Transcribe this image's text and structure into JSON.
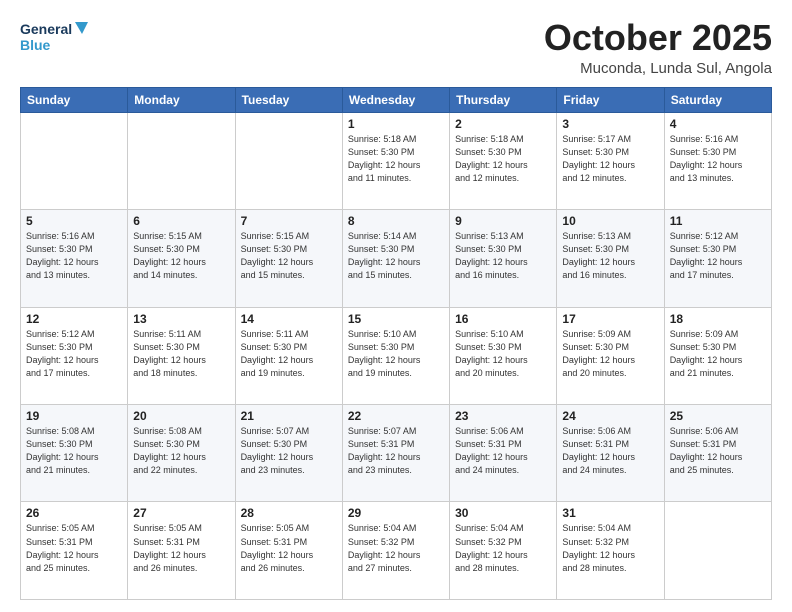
{
  "header": {
    "logo_line1": "General",
    "logo_line2": "Blue",
    "month": "October 2025",
    "location": "Muconda, Lunda Sul, Angola"
  },
  "days_of_week": [
    "Sunday",
    "Monday",
    "Tuesday",
    "Wednesday",
    "Thursday",
    "Friday",
    "Saturday"
  ],
  "weeks": [
    [
      {
        "day": "",
        "info": ""
      },
      {
        "day": "",
        "info": ""
      },
      {
        "day": "",
        "info": ""
      },
      {
        "day": "1",
        "info": "Sunrise: 5:18 AM\nSunset: 5:30 PM\nDaylight: 12 hours\nand 11 minutes."
      },
      {
        "day": "2",
        "info": "Sunrise: 5:18 AM\nSunset: 5:30 PM\nDaylight: 12 hours\nand 12 minutes."
      },
      {
        "day": "3",
        "info": "Sunrise: 5:17 AM\nSunset: 5:30 PM\nDaylight: 12 hours\nand 12 minutes."
      },
      {
        "day": "4",
        "info": "Sunrise: 5:16 AM\nSunset: 5:30 PM\nDaylight: 12 hours\nand 13 minutes."
      }
    ],
    [
      {
        "day": "5",
        "info": "Sunrise: 5:16 AM\nSunset: 5:30 PM\nDaylight: 12 hours\nand 13 minutes."
      },
      {
        "day": "6",
        "info": "Sunrise: 5:15 AM\nSunset: 5:30 PM\nDaylight: 12 hours\nand 14 minutes."
      },
      {
        "day": "7",
        "info": "Sunrise: 5:15 AM\nSunset: 5:30 PM\nDaylight: 12 hours\nand 15 minutes."
      },
      {
        "day": "8",
        "info": "Sunrise: 5:14 AM\nSunset: 5:30 PM\nDaylight: 12 hours\nand 15 minutes."
      },
      {
        "day": "9",
        "info": "Sunrise: 5:13 AM\nSunset: 5:30 PM\nDaylight: 12 hours\nand 16 minutes."
      },
      {
        "day": "10",
        "info": "Sunrise: 5:13 AM\nSunset: 5:30 PM\nDaylight: 12 hours\nand 16 minutes."
      },
      {
        "day": "11",
        "info": "Sunrise: 5:12 AM\nSunset: 5:30 PM\nDaylight: 12 hours\nand 17 minutes."
      }
    ],
    [
      {
        "day": "12",
        "info": "Sunrise: 5:12 AM\nSunset: 5:30 PM\nDaylight: 12 hours\nand 17 minutes."
      },
      {
        "day": "13",
        "info": "Sunrise: 5:11 AM\nSunset: 5:30 PM\nDaylight: 12 hours\nand 18 minutes."
      },
      {
        "day": "14",
        "info": "Sunrise: 5:11 AM\nSunset: 5:30 PM\nDaylight: 12 hours\nand 19 minutes."
      },
      {
        "day": "15",
        "info": "Sunrise: 5:10 AM\nSunset: 5:30 PM\nDaylight: 12 hours\nand 19 minutes."
      },
      {
        "day": "16",
        "info": "Sunrise: 5:10 AM\nSunset: 5:30 PM\nDaylight: 12 hours\nand 20 minutes."
      },
      {
        "day": "17",
        "info": "Sunrise: 5:09 AM\nSunset: 5:30 PM\nDaylight: 12 hours\nand 20 minutes."
      },
      {
        "day": "18",
        "info": "Sunrise: 5:09 AM\nSunset: 5:30 PM\nDaylight: 12 hours\nand 21 minutes."
      }
    ],
    [
      {
        "day": "19",
        "info": "Sunrise: 5:08 AM\nSunset: 5:30 PM\nDaylight: 12 hours\nand 21 minutes."
      },
      {
        "day": "20",
        "info": "Sunrise: 5:08 AM\nSunset: 5:30 PM\nDaylight: 12 hours\nand 22 minutes."
      },
      {
        "day": "21",
        "info": "Sunrise: 5:07 AM\nSunset: 5:30 PM\nDaylight: 12 hours\nand 23 minutes."
      },
      {
        "day": "22",
        "info": "Sunrise: 5:07 AM\nSunset: 5:31 PM\nDaylight: 12 hours\nand 23 minutes."
      },
      {
        "day": "23",
        "info": "Sunrise: 5:06 AM\nSunset: 5:31 PM\nDaylight: 12 hours\nand 24 minutes."
      },
      {
        "day": "24",
        "info": "Sunrise: 5:06 AM\nSunset: 5:31 PM\nDaylight: 12 hours\nand 24 minutes."
      },
      {
        "day": "25",
        "info": "Sunrise: 5:06 AM\nSunset: 5:31 PM\nDaylight: 12 hours\nand 25 minutes."
      }
    ],
    [
      {
        "day": "26",
        "info": "Sunrise: 5:05 AM\nSunset: 5:31 PM\nDaylight: 12 hours\nand 25 minutes."
      },
      {
        "day": "27",
        "info": "Sunrise: 5:05 AM\nSunset: 5:31 PM\nDaylight: 12 hours\nand 26 minutes."
      },
      {
        "day": "28",
        "info": "Sunrise: 5:05 AM\nSunset: 5:31 PM\nDaylight: 12 hours\nand 26 minutes."
      },
      {
        "day": "29",
        "info": "Sunrise: 5:04 AM\nSunset: 5:32 PM\nDaylight: 12 hours\nand 27 minutes."
      },
      {
        "day": "30",
        "info": "Sunrise: 5:04 AM\nSunset: 5:32 PM\nDaylight: 12 hours\nand 28 minutes."
      },
      {
        "day": "31",
        "info": "Sunrise: 5:04 AM\nSunset: 5:32 PM\nDaylight: 12 hours\nand 28 minutes."
      },
      {
        "day": "",
        "info": ""
      }
    ]
  ]
}
